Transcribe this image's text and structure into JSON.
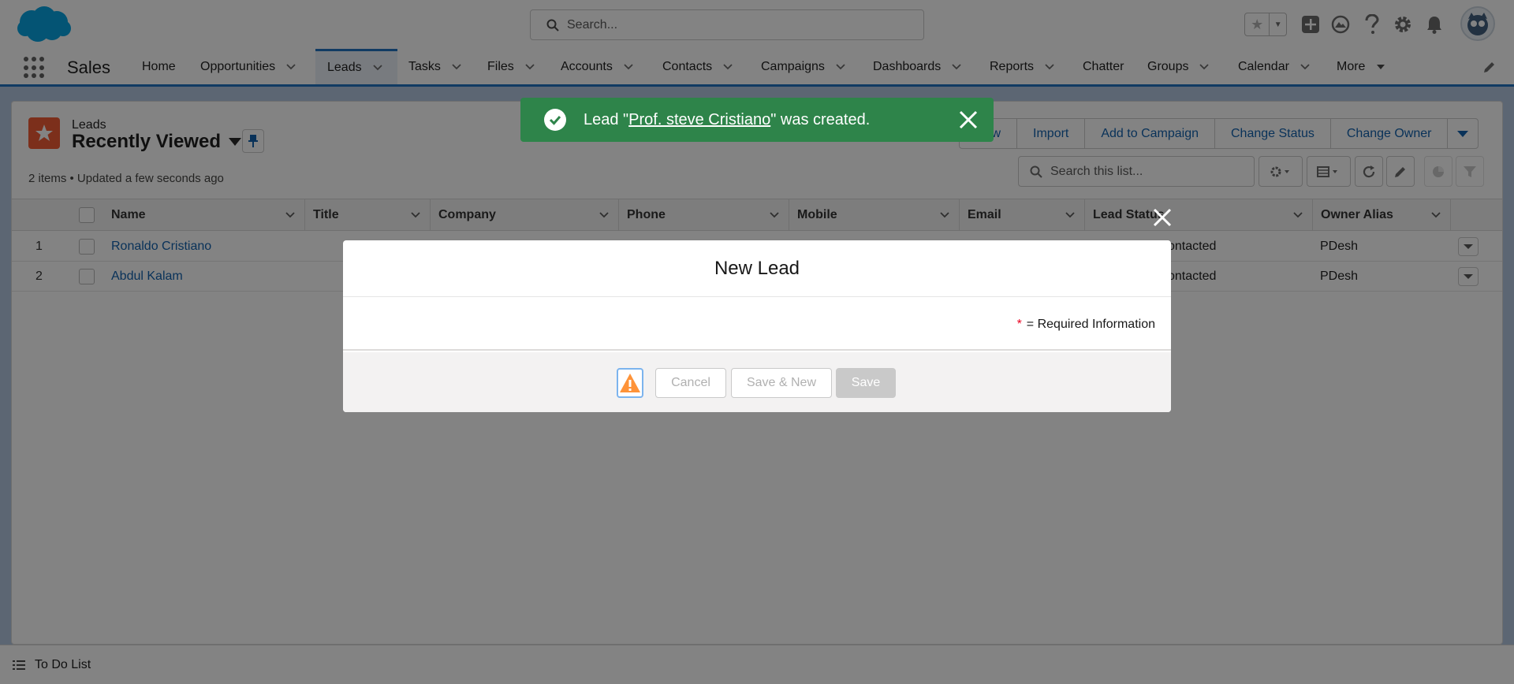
{
  "header": {
    "search_placeholder": "Search...",
    "brand_color": "#00a1e0"
  },
  "nav": {
    "app_name": "Sales",
    "items": [
      {
        "label": "Home"
      },
      {
        "label": "Opportunities"
      },
      {
        "label": "Leads"
      },
      {
        "label": "Tasks"
      },
      {
        "label": "Files"
      },
      {
        "label": "Accounts"
      },
      {
        "label": "Contacts"
      },
      {
        "label": "Campaigns"
      },
      {
        "label": "Dashboards"
      },
      {
        "label": "Reports"
      },
      {
        "label": "Chatter"
      },
      {
        "label": "Groups"
      },
      {
        "label": "Calendar"
      },
      {
        "label": "More"
      }
    ]
  },
  "list_view": {
    "object_label": "Leads",
    "title": "Recently Viewed",
    "meta": "2 items • Updated a few seconds ago",
    "actions": [
      "New",
      "Import",
      "Add to Campaign",
      "Change Status",
      "Change Owner"
    ],
    "search_placeholder": "Search this list...",
    "columns": [
      "Name",
      "Title",
      "Company",
      "Phone",
      "Mobile",
      "Email",
      "Lead Status",
      "Owner Alias"
    ],
    "rows": [
      {
        "num": "1",
        "name": "Ronaldo Cristiano",
        "status": "ontacted",
        "owner": "PDesh"
      },
      {
        "num": "2",
        "name": "Abdul Kalam",
        "status": "ontacted",
        "owner": "PDesh"
      }
    ]
  },
  "toast": {
    "prefix": "Lead \"",
    "link": "Prof. steve Cristiano",
    "suffix": "\" was created.",
    "color": "#2e844a"
  },
  "modal": {
    "title": "New Lead",
    "required_marker": "*",
    "required_text": "= Required Information",
    "cancel_label": "Cancel",
    "save_new_label": "Save & New",
    "save_label": "Save"
  },
  "utility_bar": {
    "todo_label": "To Do List"
  }
}
